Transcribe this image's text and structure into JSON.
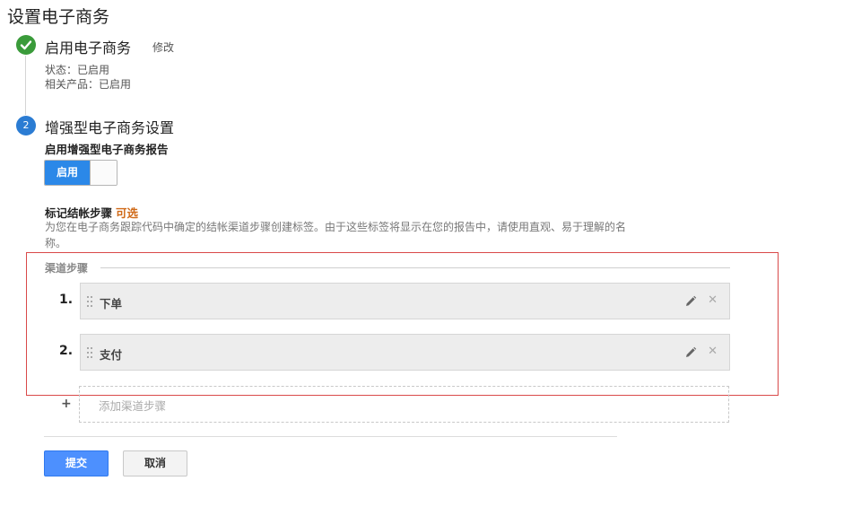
{
  "page": {
    "title": "设置电子商务"
  },
  "step1": {
    "title": "启用电子商务",
    "edit_label": "修改",
    "status_label": "状态：已启用",
    "related_label": "相关产品：已启用"
  },
  "step2": {
    "number": "2",
    "title": "增强型电子商务设置",
    "enable_reports_label": "启用增强型电子商务报告",
    "toggle_label": "启用",
    "toggle_state": "on",
    "checkout_label": "标记结帐步骤",
    "optional_label": "可选",
    "description": "为您在电子商务跟踪代码中确定的结帐渠道步骤创建标签。由于这些标签将显示在您的报告中，请使用直观、易于理解的名称。",
    "funnel_section_label": "渠道步骤",
    "funnel_steps": [
      {
        "number": "1.",
        "name": "下单"
      },
      {
        "number": "2.",
        "name": "支付"
      }
    ],
    "add_plus": "+",
    "add_step_placeholder": "添加渠道步骤"
  },
  "actions": {
    "submit_label": "提交",
    "cancel_label": "取消"
  },
  "colors": {
    "accent_blue": "#2b88e8",
    "success_green": "#3a9b3a",
    "optional_orange": "#d06a18",
    "highlight_red": "#d94a4a"
  },
  "icons": {
    "step1": "checkmark-icon",
    "drag": "drag-handle-icon",
    "edit": "pencil-icon",
    "remove": "close-icon"
  }
}
